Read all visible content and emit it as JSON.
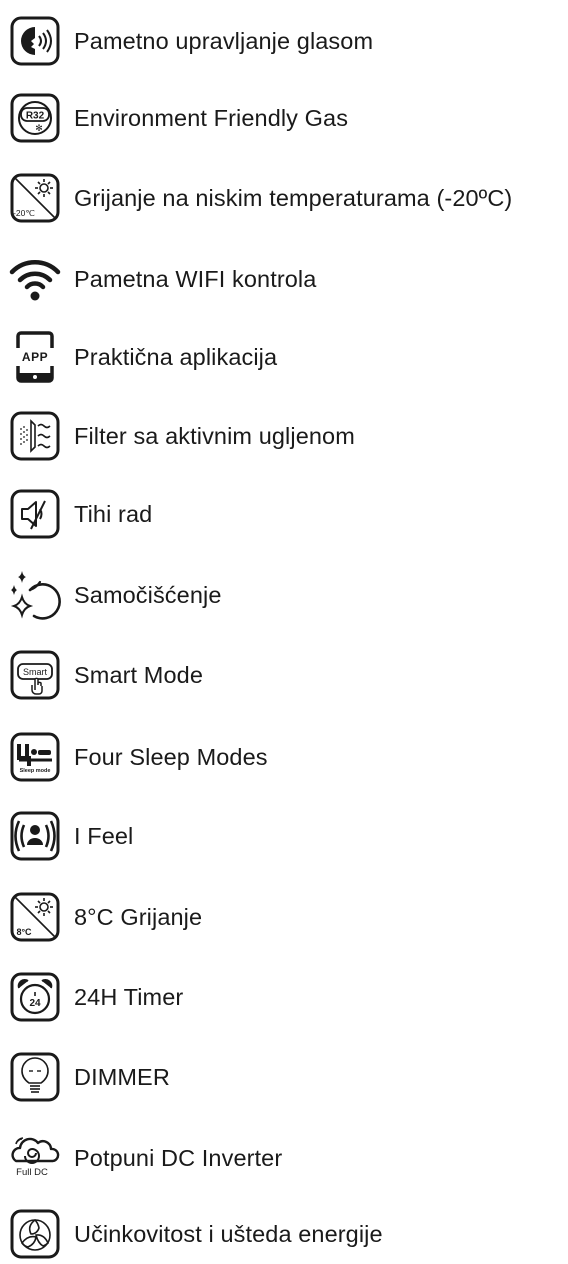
{
  "features": [
    {
      "icon": "voice-control-icon",
      "label": "Pametno upravljanje glasom"
    },
    {
      "icon": "r32-gas-icon",
      "label": "Environment Friendly Gas",
      "icon_text": "R32"
    },
    {
      "icon": "low-temp-heating-icon",
      "label": "Grijanje na niskim temperaturama (-20ºC)",
      "icon_text": "-20℃"
    },
    {
      "icon": "wifi-icon",
      "label": "Pametna WIFI kontrola"
    },
    {
      "icon": "app-phone-icon",
      "label": "Praktična aplikacija",
      "icon_text": "APP"
    },
    {
      "icon": "carbon-filter-icon",
      "label": "Filter sa aktivnim ugljenom"
    },
    {
      "icon": "mute-speaker-icon",
      "label": "Tihi rad"
    },
    {
      "icon": "self-clean-icon",
      "label": "Samočišćenje"
    },
    {
      "icon": "smart-mode-icon",
      "label": "Smart Mode",
      "icon_text": "Smart"
    },
    {
      "icon": "sleep-mode-icon",
      "label": "Four Sleep Modes",
      "icon_text": "Sleep mode"
    },
    {
      "icon": "i-feel-icon",
      "label": "I Feel"
    },
    {
      "icon": "8c-heating-icon",
      "label": "8°C Grijanje",
      "icon_text": "8°C"
    },
    {
      "icon": "timer-24h-icon",
      "label": "24H Timer",
      "icon_text": "24"
    },
    {
      "icon": "dimmer-bulb-icon",
      "label": "DIMMER"
    },
    {
      "icon": "full-dc-inverter-icon",
      "label": "Potpuni DC Inverter",
      "icon_text": "Full DC"
    },
    {
      "icon": "eco-energy-icon",
      "label": "Učinkovitost i ušteda energije"
    }
  ]
}
